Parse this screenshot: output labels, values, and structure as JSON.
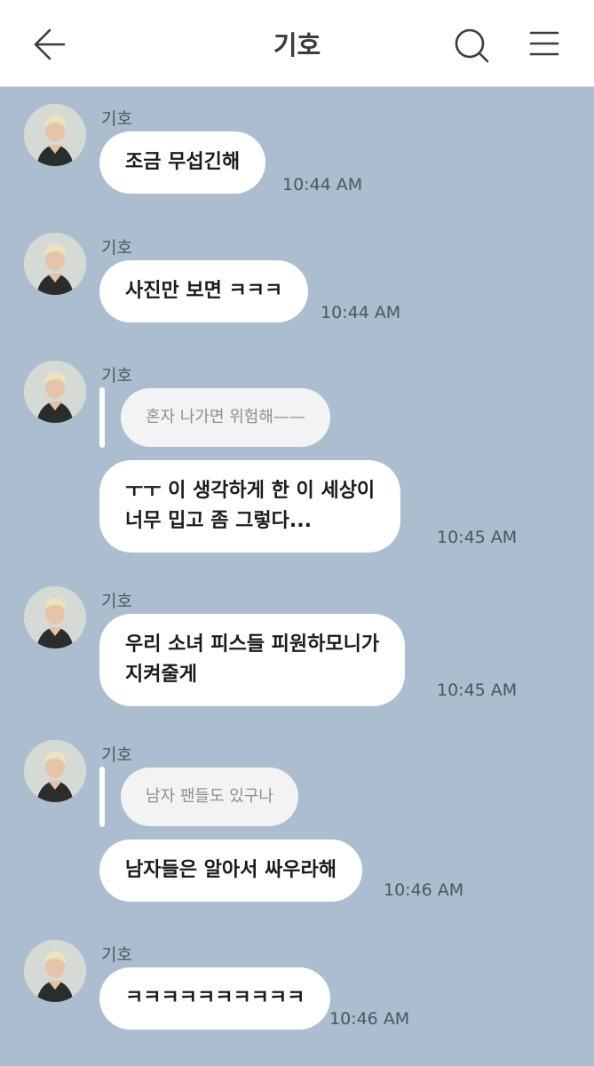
{
  "header": {
    "title": "기호",
    "back_icon": "arrow-left-icon",
    "search_icon": "search-icon",
    "menu_icon": "hamburger-menu-icon"
  },
  "colors": {
    "background": "#abbdcf",
    "bubble": "#ffffff",
    "reply_bubble": "#f3f3f5"
  },
  "messages": [
    {
      "sender": "기호",
      "text_lines": [
        "조금 무섭긴해"
      ],
      "time": "10:44 AM"
    },
    {
      "sender": "기호",
      "text_lines": [
        "사진만 보면 ㅋㅋㅋ"
      ],
      "time": "10:44 AM"
    },
    {
      "sender": "기호",
      "reply_to": "혼자 나가면 위험해——",
      "text_lines": [
        "ㅜㅜ 이 생각하게 한 이 세상이",
        "너무 밉고 좀 그렇다..."
      ],
      "time": "10:45 AM"
    },
    {
      "sender": "기호",
      "text_lines": [
        "우리 소녀 피스들 피원하모니가",
        "지켜줄게"
      ],
      "time": "10:45 AM"
    },
    {
      "sender": "기호",
      "reply_to": "남자 팬들도 있구나",
      "text_lines": [
        "남자들은 알아서 싸우라해"
      ],
      "time": "10:46 AM"
    },
    {
      "sender": "기호",
      "text_lines": [
        "ㅋㅋㅋㅋㅋㅋㅋㅋㅋㅋ"
      ],
      "time": "10:46 AM"
    }
  ]
}
